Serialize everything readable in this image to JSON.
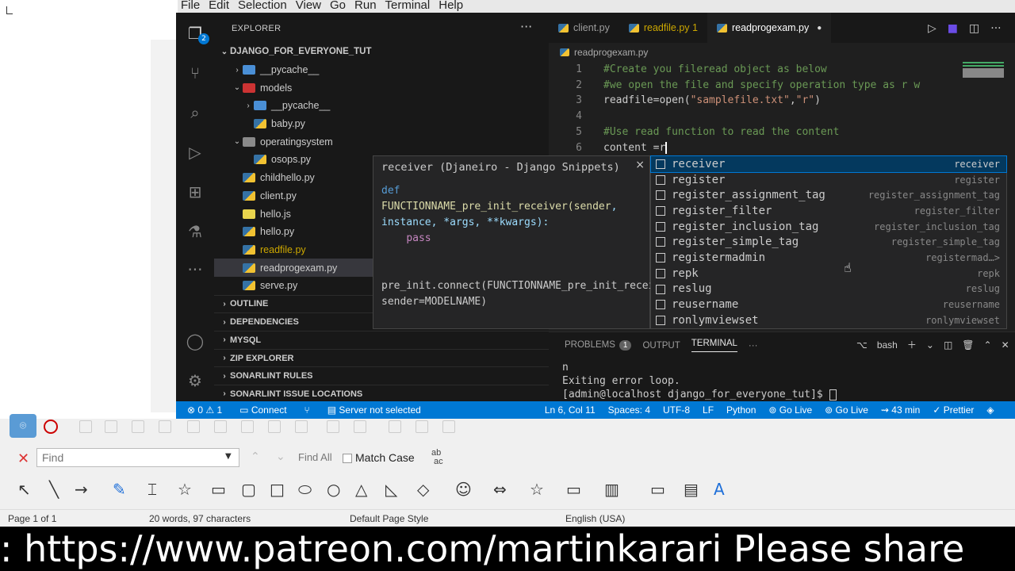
{
  "menubar": [
    "File",
    "Edit",
    "Selection",
    "View",
    "Go",
    "Run",
    "Terminal",
    "Help"
  ],
  "activity": {
    "explorer_badge": "2"
  },
  "explorer": {
    "title": "EXPLORER",
    "root": "DJANGO_FOR_EVERYONE_TUT",
    "items": [
      {
        "label": "__pycache__",
        "indent": 1,
        "kind": "folder-blue",
        "chev": "›"
      },
      {
        "label": "models",
        "indent": 1,
        "kind": "folder-red",
        "chev": "⌄"
      },
      {
        "label": "__pycache__",
        "indent": 2,
        "kind": "folder-blue",
        "chev": "›"
      },
      {
        "label": "baby.py",
        "indent": 2,
        "kind": "py"
      },
      {
        "label": "operatingsystem",
        "indent": 1,
        "kind": "folder-gray",
        "chev": "⌄"
      },
      {
        "label": "osops.py",
        "indent": 2,
        "kind": "py"
      },
      {
        "label": "childhello.py",
        "indent": 1,
        "kind": "py"
      },
      {
        "label": "client.py",
        "indent": 1,
        "kind": "py"
      },
      {
        "label": "hello.js",
        "indent": 1,
        "kind": "js"
      },
      {
        "label": "hello.py",
        "indent": 1,
        "kind": "py"
      },
      {
        "label": "readfile.py",
        "indent": 1,
        "kind": "py",
        "modified": true
      },
      {
        "label": "readprogexam.py",
        "indent": 1,
        "kind": "py",
        "selected": true
      },
      {
        "label": "serve.py",
        "indent": 1,
        "kind": "py"
      }
    ],
    "sections": [
      "OUTLINE",
      "DEPENDENCIES",
      "MYSQL",
      "ZIP EXPLORER",
      "SONARLINT RULES",
      "SONARLINT ISSUE LOCATIONS"
    ]
  },
  "tabs": [
    {
      "label": "client.py",
      "active": false
    },
    {
      "label": "readfile.py 1",
      "active": false,
      "modified": true
    },
    {
      "label": "readprogexam.py",
      "active": true,
      "dirty": true
    }
  ],
  "breadcrumb": "readprogexam.py",
  "code": [
    {
      "n": "1",
      "parts": [
        [
          "cm",
          "#Create you fileread object as below"
        ]
      ]
    },
    {
      "n": "2",
      "parts": [
        [
          "cm",
          "#we open the file and specify operation type as r w"
        ]
      ]
    },
    {
      "n": "3",
      "parts": [
        [
          "tx",
          "readfile=open("
        ],
        [
          "st",
          "\"samplefile.txt\""
        ],
        [
          "tx",
          ","
        ],
        [
          "st",
          "\"r\""
        ],
        [
          "tx",
          ")"
        ]
      ]
    },
    {
      "n": "4",
      "parts": []
    },
    {
      "n": "5",
      "parts": [
        [
          "cm",
          "#Use read function to read the content"
        ]
      ]
    },
    {
      "n": "6",
      "parts": [
        [
          "tx",
          "content =r"
        ]
      ]
    }
  ],
  "suggest": [
    {
      "label": "receiver",
      "detail": "receiver",
      "selected": true
    },
    {
      "label": "register",
      "detail": "register"
    },
    {
      "label": "register_assignment_tag",
      "detail": "register_assignment_tag"
    },
    {
      "label": "register_filter",
      "detail": "register_filter"
    },
    {
      "label": "register_inclusion_tag",
      "detail": "register_inclusion_tag"
    },
    {
      "label": "register_simple_tag",
      "detail": "register_simple_tag"
    },
    {
      "label": "registermadmin",
      "detail": "registermad…>"
    },
    {
      "label": "repk",
      "detail": "repk"
    },
    {
      "label": "reslug",
      "detail": "reslug"
    },
    {
      "label": "reusername",
      "detail": "reusername"
    },
    {
      "label": "ronlymviewset",
      "detail": "ronlymviewset"
    }
  ],
  "doc": {
    "title": "receiver (Djaneiro - Django Snippets)",
    "close": "×",
    "kw_def": "def",
    "fn_line": "FUNCTIONNAME_pre_init_receiver(sender",
    "params_line": ", instance, *args, **kwargs):",
    "pass": "pass",
    "connect_line": "pre_init.connect(FUNCTIONNAME_pre_init_receiver, sender=MODELNAME)"
  },
  "panel": {
    "tabs": [
      "PROBLEMS",
      "OUTPUT",
      "TERMINAL"
    ],
    "problems_count": "1",
    "shell": "bash",
    "terminal": [
      "n",
      "Exiting error loop.",
      "[admin@localhost django_for_everyone_tut]$ "
    ]
  },
  "status": {
    "errors": "⊗ 0 ⚠ 1",
    "connect": "Connect",
    "server": "Server not selected",
    "position": "Ln 6, Col 11",
    "spaces": "Spaces: 4",
    "encoding": "UTF-8",
    "eol": "LF",
    "language": "Python",
    "golive1": "Go Live",
    "golive2": "Go Live",
    "time": "43 min",
    "prettier": "Prettier"
  },
  "lo": {
    "find_placeholder": "Find",
    "find_all": "Find All",
    "match_case": "Match Case",
    "page": "Page 1 of 1",
    "words": "20 words, 97 characters",
    "style": "Default Page Style",
    "lang": "English (USA)"
  },
  "banner": ": https://www.patreon.com/martinkarari Please share"
}
